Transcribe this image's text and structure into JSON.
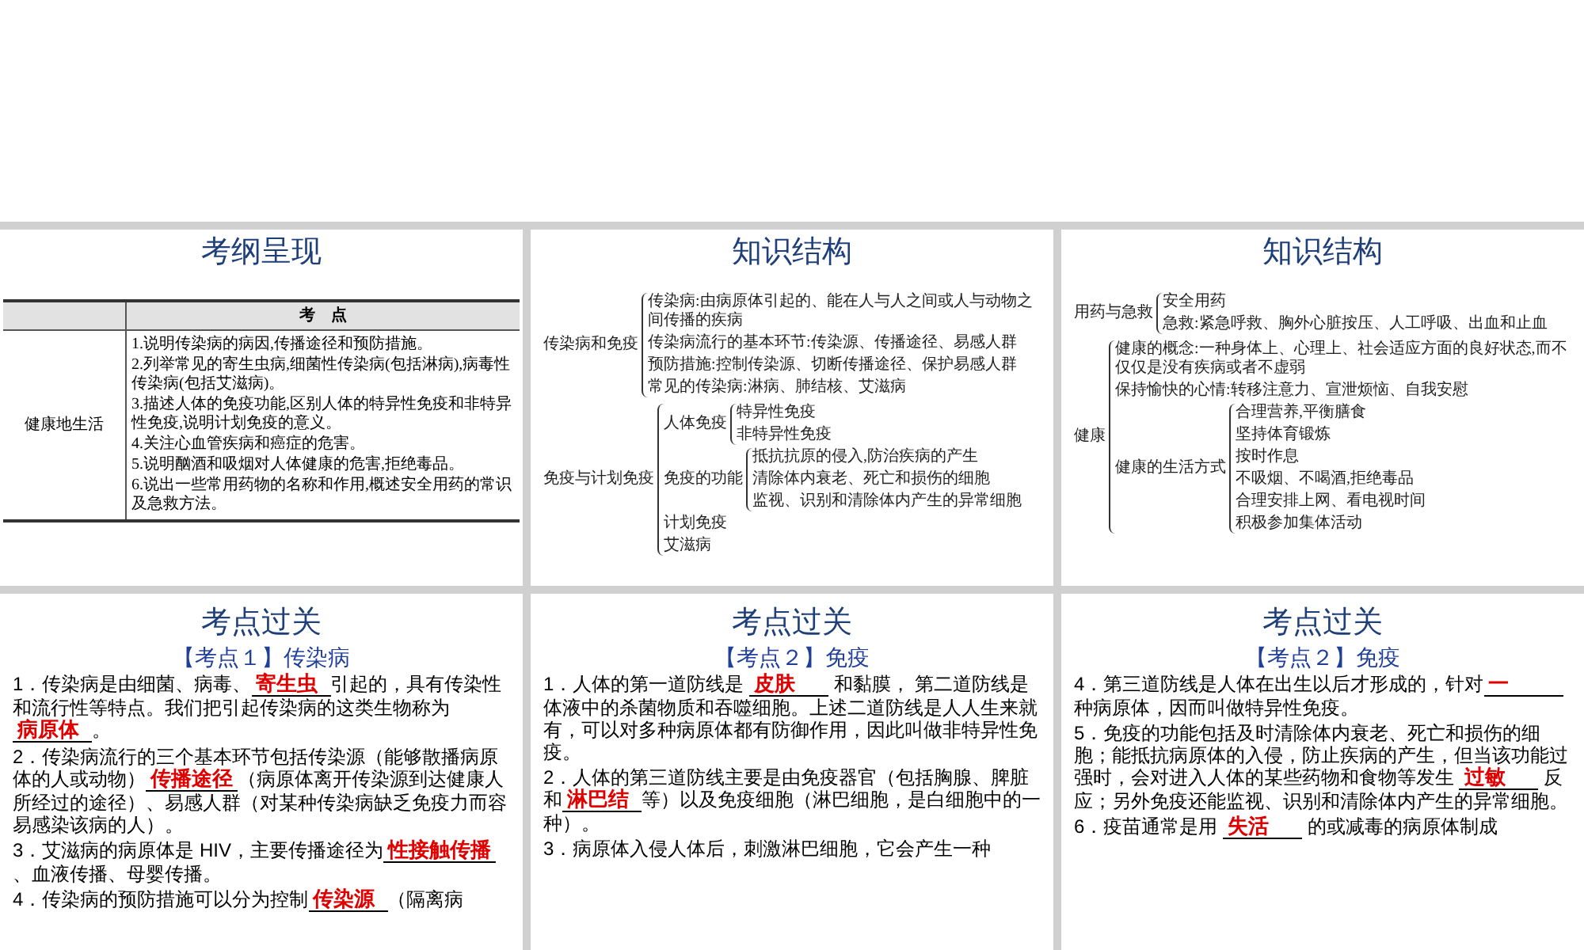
{
  "slides": [
    {
      "kind": "table",
      "title": "考纲呈现",
      "table": {
        "header": "考　点",
        "row_label": "健康地生活",
        "items": [
          "1.说明传染病的病因,传播途径和预防措施。",
          "2.列举常见的寄生虫病,细菌性传染病(包括淋病),病毒性传染病(包括艾滋病)。",
          "3.描述人体的免疫功能,区别人体的特异性免疫和非特异性免疫,说明计划免疫的意义。",
          "4.关注心血管疾病和癌症的危害。",
          "5.说明酗酒和吸烟对人体健康的危害,拒绝毒品。",
          "6.说出一些常用药物的名称和作用,概述安全用药的常识及急救方法。"
        ]
      }
    },
    {
      "kind": "tree",
      "title": "知识结构",
      "tree": [
        {
          "label": "传染病和免疫",
          "children": [
            {
              "label": "传染病:由病原体引起的、能在人与人之间或人与动物之间传播的疾病"
            },
            {
              "label": "传染病流行的基本环节:传染源、传播途径、易感人群"
            },
            {
              "label": "预防措施:控制传染源、切断传播途径、保护易感人群"
            },
            {
              "label": "常见的传染病:淋病、肺结核、艾滋病"
            }
          ]
        },
        {
          "label": "免疫与计划免疫",
          "children": [
            {
              "label": "人体免疫",
              "children": [
                {
                  "label": "特异性免疫"
                },
                {
                  "label": "非特异性免疫"
                }
              ]
            },
            {
              "label": "免疫的功能",
              "children": [
                {
                  "label": "抵抗抗原的侵入,防治疾病的产生"
                },
                {
                  "label": "清除体内衰老、死亡和损伤的细胞"
                },
                {
                  "label": "监视、识别和清除体内产生的异常细胞"
                }
              ]
            },
            {
              "label": "计划免疫"
            },
            {
              "label": "艾滋病"
            }
          ]
        }
      ]
    },
    {
      "kind": "tree",
      "title": "知识结构",
      "tree": [
        {
          "label": "用药与急救",
          "children": [
            {
              "label": "安全用药"
            },
            {
              "label": "急救:紧急呼救、胸外心脏按压、人工呼吸、出血和止血"
            }
          ]
        },
        {
          "label": "健康",
          "children": [
            {
              "label": "健康的概念:一种身体上、心理上、社会适应方面的良好状态,而不仅仅是没有疾病或者不虚弱"
            },
            {
              "label": "保持愉快的心情:转移注意力、宣泄烦恼、自我安慰"
            },
            {
              "label": "健康的生活方式",
              "children": [
                {
                  "label": "合理营养,平衡膳食"
                },
                {
                  "label": "坚持体育锻炼"
                },
                {
                  "label": "按时作息"
                },
                {
                  "label": "不吸烟、不喝酒,拒绝毒品"
                },
                {
                  "label": "合理安排上网、看电视时间"
                },
                {
                  "label": "积极参加集体活动"
                }
              ]
            }
          ]
        }
      ]
    },
    {
      "kind": "text",
      "title": "考点过关",
      "heading": "【考点１】传染病",
      "paragraphs": [
        [
          {
            "kind": "text",
            "text": "1．传染病是由细菌、病毒、"
          },
          {
            "kind": "blank",
            "answer": "寄生虫"
          },
          {
            "kind": "text",
            "text": "引起的，具有传染性和流行性等特点。我们把引起传染病的这类生物称为"
          },
          {
            "kind": "blank",
            "answer": "病原体"
          },
          {
            "kind": "text",
            "text": "。"
          }
        ],
        [
          {
            "kind": "text",
            "text": "2．传染病流行的三个基本环节包括传染源（能够散播病原体的人或动物）"
          },
          {
            "kind": "blank",
            "answer": "传播途径"
          },
          {
            "kind": "text",
            "text": "（病原体离开传染源到达健康人所经过的途径）、易感人群（对某种传染病缺乏免疫力而容易感染该病的人）。"
          }
        ],
        [
          {
            "kind": "text",
            "text": "3．艾滋病的病原体是 HIV，主要传播途径为"
          },
          {
            "kind": "blank",
            "answer": "性接触传播"
          },
          {
            "kind": "text",
            "text": "、血液传播、母婴传播。"
          }
        ],
        [
          {
            "kind": "text",
            "text": "4．传染病的预防措施可以分为控制"
          },
          {
            "kind": "blank",
            "answer": "传染源"
          },
          {
            "kind": "text",
            "text": "（隔离病"
          }
        ]
      ]
    },
    {
      "kind": "text",
      "title": "考点过关",
      "heading": "【考点２】免疫",
      "paragraphs": [
        [
          {
            "kind": "text",
            "text": "1．人体的第一道防线是 "
          },
          {
            "kind": "blank",
            "answer": "皮肤"
          },
          {
            "kind": "text",
            "text": " 和黏膜，  第二道防线是体液中的杀菌物质和吞噬细胞。上述二道防线是人人生来就有，可以对多种病原体都有防御作用，因此叫做非特异性免疫。"
          }
        ],
        [
          {
            "kind": "text",
            "text": "2．人体的第三道防线主要是由免疫器官（包括胸腺、脾脏和"
          },
          {
            "kind": "blank",
            "answer": "淋巴结"
          },
          {
            "kind": "text",
            "text": "等）以及免疫细胞（淋巴细胞，是白细胞中的一种）。"
          }
        ],
        [
          {
            "kind": "text",
            "text": "3．病原体入侵人体后，刺激淋巴细胞，它会产生一种"
          }
        ]
      ]
    },
    {
      "kind": "text",
      "title": "考点过关",
      "heading": "【考点２】免疫",
      "paragraphs": [
        [
          {
            "kind": "text",
            "text": "4．第三道防线是人体在出生以后才形成的，针对"
          },
          {
            "kind": "blank",
            "answer": "一"
          },
          {
            "kind": "text",
            "text": "种病原体，因而叫做特异性免疫。"
          }
        ],
        [
          {
            "kind": "text",
            "text": "5．免疫的功能包括及时清除体内衰老、死亡和损伤的细胞；能抵抗病原体的入侵，防止疾病的产生，但当该功能过强时，会对进入人体的某些药物和食物等发生 "
          },
          {
            "kind": "blank",
            "answer": "过敏"
          },
          {
            "kind": "text",
            "text": " 反应；另外免疫还能监视、识别和清除体内产生的异常细胞。"
          }
        ],
        [
          {
            "kind": "text",
            "text": "6．疫苗通常是用 "
          },
          {
            "kind": "blank",
            "answer": "失活"
          },
          {
            "kind": "text",
            "text": " 的或减毒的病原体制成"
          }
        ]
      ]
    }
  ]
}
